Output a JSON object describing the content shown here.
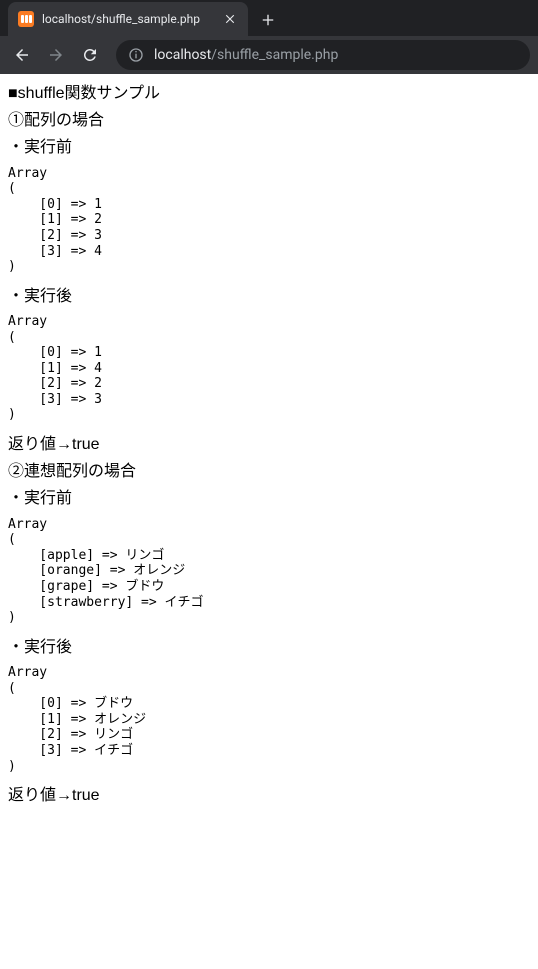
{
  "browser": {
    "tab_title": "localhost/shuffle_sample.php",
    "url_host": "localhost",
    "url_path": "/shuffle_sample.php"
  },
  "page": {
    "title": "■shuffle関数サンプル",
    "section1_title": "①配列の場合",
    "before_label": "・実行前",
    "after_label": "・実行後",
    "array1_before": "Array\n(\n    [0] => 1\n    [1] => 2\n    [2] => 3\n    [3] => 4\n)",
    "array1_after": "Array\n(\n    [0] => 1\n    [1] => 4\n    [2] => 2\n    [3] => 3\n)",
    "return1": "返り値→true",
    "section2_title": "②連想配列の場合",
    "array2_before": "Array\n(\n    [apple] => リンゴ\n    [orange] => オレンジ\n    [grape] => ブドウ\n    [strawberry] => イチゴ\n)",
    "array2_after": "Array\n(\n    [0] => ブドウ\n    [1] => オレンジ\n    [2] => リンゴ\n    [3] => イチゴ\n)",
    "return2": "返り値→true"
  }
}
